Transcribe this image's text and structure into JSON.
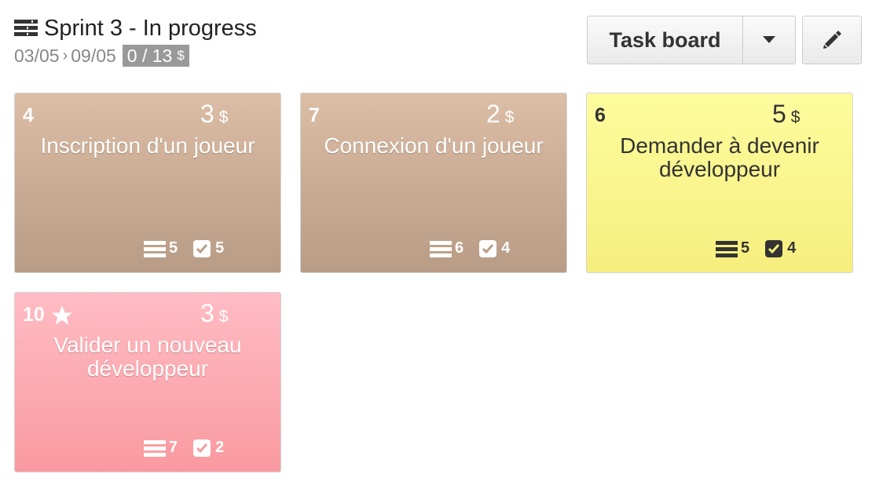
{
  "header": {
    "title": "Sprint 3 - In progress",
    "start_date": "03/05",
    "end_date": "09/05",
    "points": "0 / 13",
    "currency": "$"
  },
  "toolbar": {
    "view_label": "Task board"
  },
  "colors": {
    "brown": "#c8aa93",
    "yellow": "#faf48c",
    "pink": "#fcaab0",
    "badge": "#999999"
  },
  "cards": [
    {
      "number": "4",
      "points": "3",
      "currency": "$",
      "title": "Inscription d'un joueur",
      "tasks": "5",
      "checks": "5",
      "color": "brown"
    },
    {
      "number": "7",
      "points": "2",
      "currency": "$",
      "title": "Connexion d'un joueur",
      "tasks": "6",
      "checks": "4",
      "color": "brown"
    },
    {
      "number": "6",
      "points": "5",
      "currency": "$",
      "title": "Demander à devenir développeur",
      "tasks": "5",
      "checks": "4",
      "color": "yellow"
    },
    {
      "number": "10",
      "points": "3",
      "currency": "$",
      "title": "Valider un nouveau développeur",
      "tasks": "7",
      "checks": "2",
      "color": "pink",
      "starred": true
    }
  ]
}
